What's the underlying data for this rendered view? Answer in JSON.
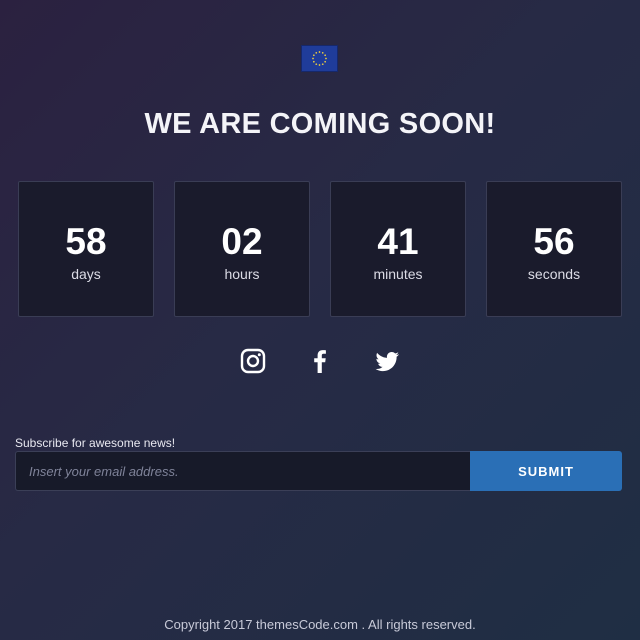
{
  "header": {
    "flag_icon": "eu-flag-icon",
    "title": "WE ARE COMING SOON!"
  },
  "countdown": {
    "items": [
      {
        "value": "58",
        "unit": "days"
      },
      {
        "value": "02",
        "unit": "hours"
      },
      {
        "value": "41",
        "unit": "minutes"
      },
      {
        "value": "56",
        "unit": "seconds"
      }
    ]
  },
  "social": {
    "icons": [
      "instagram-icon",
      "facebook-icon",
      "twitter-icon"
    ]
  },
  "subscribe": {
    "label": "Subscribe for awesome news!",
    "email_placeholder": "Insert your email address.",
    "email_value": "",
    "submit_label": "SUBMIT"
  },
  "footer": {
    "copyright": "Copyright 2017 themesCode.com . All rights reserved."
  },
  "colors": {
    "accent": "#2a6fb6",
    "box_background": "#1a1b2c",
    "text": "#ffffff"
  }
}
